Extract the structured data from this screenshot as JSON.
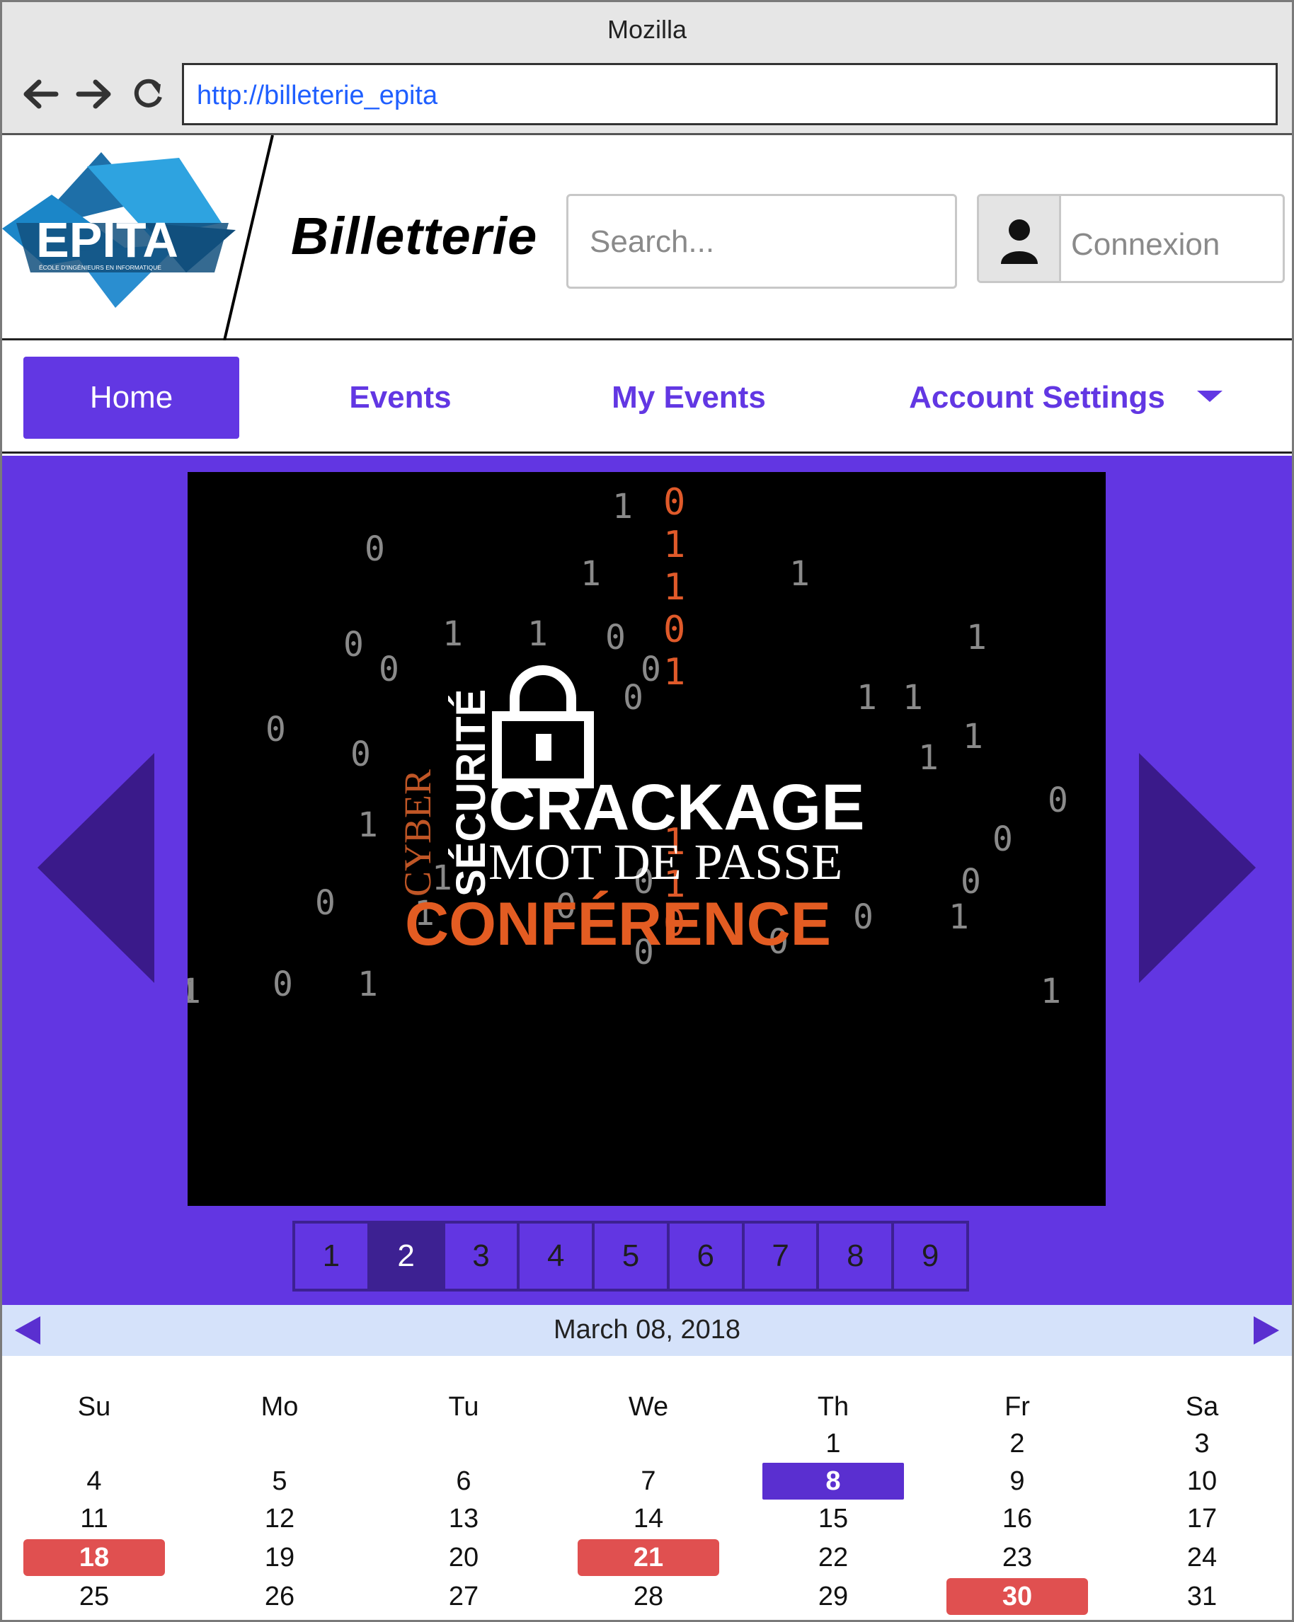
{
  "browser": {
    "window_title": "Mozilla",
    "url": "http://billeterie_epita",
    "icons": [
      "back-arrow-icon",
      "forward-arrow-icon",
      "reload-icon"
    ]
  },
  "header": {
    "logo_text": "EPITA",
    "logo_tagline": "ÉCOLE D'INGÉNIEURS EN INFORMATIQUE",
    "brand": "Billetterie",
    "search_placeholder": "Search...",
    "login_label": "Connexion",
    "login_icon": "user-icon"
  },
  "nav": {
    "items": [
      {
        "label": "Home",
        "active": true
      },
      {
        "label": "Events",
        "active": false
      },
      {
        "label": "My Events",
        "active": false
      },
      {
        "label": "Account Settings",
        "active": false,
        "dropdown": true
      }
    ],
    "active_color": "#6237e3"
  },
  "carousel": {
    "background_color": "#6236e2",
    "slide": {
      "word_cyber": "CYBER",
      "word_securite": "SÉCURITÉ",
      "headline": "CRACKAGE",
      "subheadline": "MOT DE PASSE",
      "event_type": "CONFÉRENCE",
      "binary_digits_white": [
        "0",
        "1",
        "1",
        "1",
        "1",
        "0",
        "1",
        "0",
        "0",
        "0",
        "0",
        "1",
        "1",
        "0",
        "0",
        "1",
        "1",
        "0",
        "1",
        "0",
        "1",
        "0",
        "0",
        "0",
        "1",
        "0",
        "0",
        "1",
        "0",
        "0",
        "1",
        "0",
        "1",
        "1",
        "0",
        "1",
        "1"
      ],
      "binary_digits_orange": [
        "0",
        "1",
        "1",
        "0",
        "1",
        "1",
        "1",
        "0"
      ]
    },
    "pages": [
      "1",
      "2",
      "3",
      "4",
      "5",
      "6",
      "7",
      "8",
      "9"
    ],
    "active_page": "2"
  },
  "calendar": {
    "title": "March 08, 2018",
    "weekdays": [
      "Su",
      "Mo",
      "Tu",
      "We",
      "Th",
      "Fr",
      "Sa"
    ],
    "weeks": [
      [
        "",
        "",
        "",
        "",
        "1",
        "2",
        "3"
      ],
      [
        "4",
        "5",
        "6",
        "7",
        "8",
        "9",
        "10"
      ],
      [
        "11",
        "12",
        "13",
        "14",
        "15",
        "16",
        "17"
      ],
      [
        "18",
        "19",
        "20",
        "21",
        "22",
        "23",
        "24"
      ],
      [
        "25",
        "26",
        "27",
        "28",
        "29",
        "30",
        "31"
      ]
    ],
    "selected_day": "8",
    "event_days": [
      "18",
      "21",
      "30"
    ],
    "selected_color": "#5a2fd0",
    "event_color": "#e05050"
  }
}
